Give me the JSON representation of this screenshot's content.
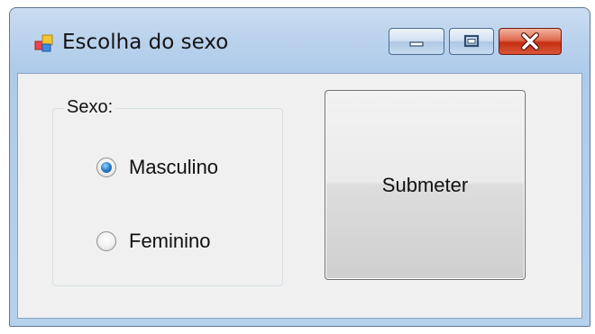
{
  "window": {
    "title": "Escolha do sexo",
    "app_icon": "windows-form-icon",
    "controls": {
      "minimize_icon": "minimize-icon",
      "maximize_icon": "maximize-icon",
      "close_icon": "close-icon"
    },
    "colors": {
      "close_accent": "#c52f12",
      "frame": "#b9d1ec"
    }
  },
  "form": {
    "group": {
      "label": "Sexo:",
      "options": [
        {
          "label": "Masculino",
          "selected": true
        },
        {
          "label": "Feminino",
          "selected": false
        }
      ]
    },
    "submit_label": "Submeter"
  }
}
